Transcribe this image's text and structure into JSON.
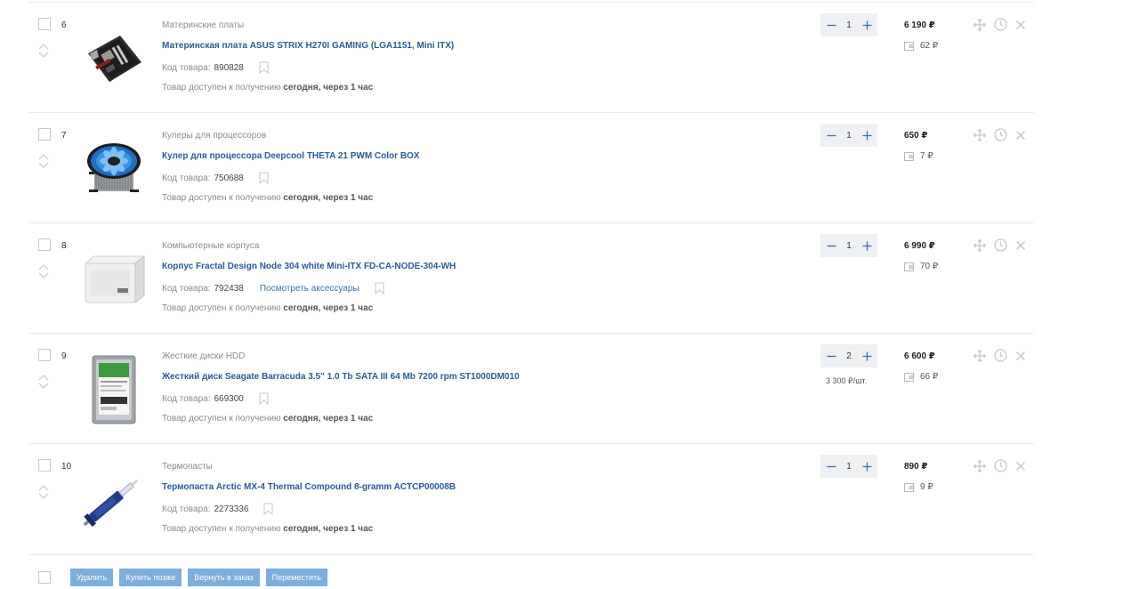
{
  "items": [
    {
      "index": "6",
      "category": "Материнские платы",
      "title": "Материнская плата ASUS STRIX H270I GAMING (LGA1151, Mini ITX)",
      "code_label": "Код товара:",
      "code": "890828",
      "accessories": "",
      "availability_prefix": "Товар доступен к получению",
      "availability_bold": "сегодня, через 1 час",
      "qty": "1",
      "unit_price": "",
      "price": "6 190 ₽",
      "bonus": "62 ₽",
      "image": "motherboard"
    },
    {
      "index": "7",
      "category": "Кулеры для процессоров",
      "title": "Кулер для процессора Deepcool THETA 21 PWM Color BOX",
      "code_label": "Код товара:",
      "code": "750688",
      "accessories": "",
      "availability_prefix": "Товар доступен к получению",
      "availability_bold": "сегодня, через 1 час",
      "qty": "1",
      "unit_price": "",
      "price": "650 ₽",
      "bonus": "7 ₽",
      "image": "cooler"
    },
    {
      "index": "8",
      "category": "Компьютерные корпуса",
      "title": "Корпус Fractal Design Node 304 white Mini-ITX FD-CA-NODE-304-WH",
      "code_label": "Код товара:",
      "code": "792438",
      "accessories": "Посмотреть аксессуары",
      "availability_prefix": "Товар доступен к получению",
      "availability_bold": "сегодня, через 1 час",
      "qty": "1",
      "unit_price": "",
      "price": "6 990 ₽",
      "bonus": "70 ₽",
      "image": "case"
    },
    {
      "index": "9",
      "category": "Жесткие диски HDD",
      "title": "Жесткий диск Seagate Barracuda 3.5\" 1.0 Tb SATA III 64 Mb 7200 rpm ST1000DM010",
      "code_label": "Код товара:",
      "code": "669300",
      "accessories": "",
      "availability_prefix": "Товар доступен к получению",
      "availability_bold": "сегодня, через 1 час",
      "qty": "2",
      "unit_price": "3 300 ₽/шт.",
      "price": "6 600 ₽",
      "bonus": "66 ₽",
      "image": "hdd"
    },
    {
      "index": "10",
      "category": "Термопасты",
      "title": "Термопаста Arctic MX-4 Thermal Compound 8-gramm ACTCP00008B",
      "code_label": "Код товара:",
      "code": "2273336",
      "accessories": "",
      "availability_prefix": "Товар доступен к получению",
      "availability_bold": "сегодня, через 1 час",
      "qty": "1",
      "unit_price": "",
      "price": "890 ₽",
      "bonus": "9 ₽",
      "image": "thermal-paste"
    }
  ],
  "icons": {
    "minus": "minus-icon",
    "plus": "plus-icon",
    "move": "move-icon",
    "later": "clock-icon",
    "remove": "close-icon",
    "bookmark": "bookmark-icon",
    "bonus": "wallet-icon",
    "up": "chevron-up-icon",
    "down": "chevron-down-icon"
  },
  "colors": {
    "link": "#2a5a9e",
    "button": "#7eaede",
    "qty_bg": "#eef0f2",
    "icon": "#c4c8cc"
  },
  "footer": {
    "delete": "Удалить",
    "buy_later": "Купить позже",
    "return_to_order": "Вернуть в заказ",
    "move": "Переместить"
  }
}
